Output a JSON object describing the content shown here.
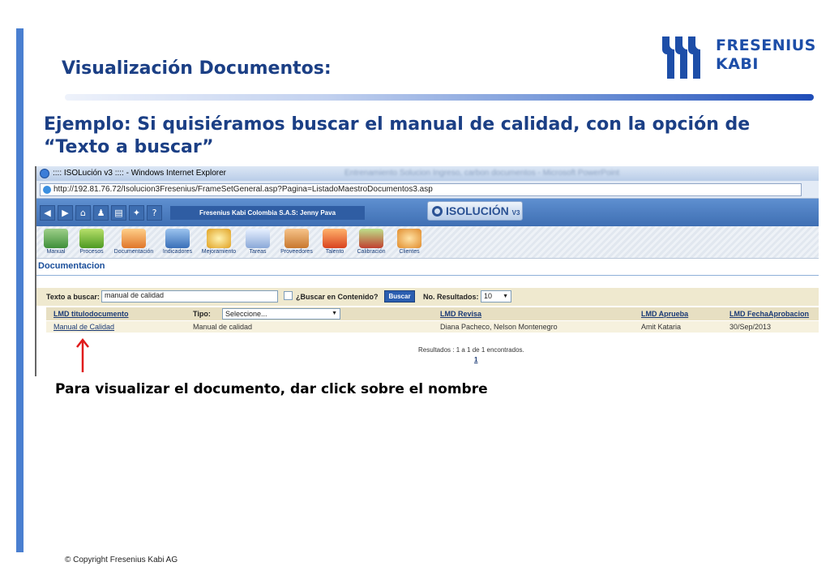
{
  "slide": {
    "title": "Visualización Documentos:",
    "subtitle": "Ejemplo: Si quisiéramos buscar el manual de calidad, con la opción de “Texto a buscar”",
    "caption": "Para visualizar el documento, dar click sobre el nombre",
    "copyright": "© Copyright Fresenius Kabi AG",
    "logo_line1": "FRESENIUS",
    "logo_line2": "KABI",
    "colors": {
      "title": "#1b3f85",
      "accent": "#4a7fd0",
      "logo": "#1d4ea8",
      "arrow": "#e01b1b"
    }
  },
  "browser": {
    "window_title": ":::: ISOLución v3 :::: - Windows Internet Explorer",
    "taskbar_blur": "Entrenamiento Solucion Ingreso, carbon documentos - Microsoft PowerPoint",
    "url": "http://192.81.76.72/Isolucion3Fresenius/FrameSetGeneral.asp?Pagina=ListadoMaestroDocumentos3.asp"
  },
  "app": {
    "company_banner": "Fresenius Kabi Colombia S.A.S: Jenny Pava",
    "logo": "ISOLUCIÓN",
    "logo_version": "V3",
    "nav_icons": [
      "back-icon",
      "forward-icon",
      "home-icon",
      "user-icon",
      "print-icon",
      "settings-icon",
      "help-icon"
    ],
    "modules": [
      "Manual",
      "Procesos",
      "Documentación",
      "Indicadores",
      "Mejoramiento",
      "Tareas",
      "Proveedores",
      "Talento",
      "Calibración",
      "Clientes"
    ],
    "section_title": "Documentacion",
    "search": {
      "label": "Texto a buscar:",
      "value": "manual de calidad",
      "content_label": "¿Buscar en Contenido?",
      "button": "Buscar",
      "results_label": "No. Resultados:",
      "results_value": "10"
    },
    "table": {
      "col_titulo": "LMD titulodocumento",
      "col_tipo": "Tipo:",
      "tipo_value": "Seleccione...",
      "col_revisa": "LMD Revisa",
      "col_aprueba": "LMD Aprueba",
      "col_fecha": "LMD FechaAprobacion",
      "row": {
        "titulo": "Manual de Calidad",
        "tipo": "Manual de calidad",
        "revisa": "Diana Pacheco, Nelson Montenegro",
        "aprueba": "Amit Kataria",
        "fecha": "30/Sep/2013"
      }
    },
    "results_text": "Resultados : 1 a 1 de 1 encontrados.",
    "page": "1"
  }
}
